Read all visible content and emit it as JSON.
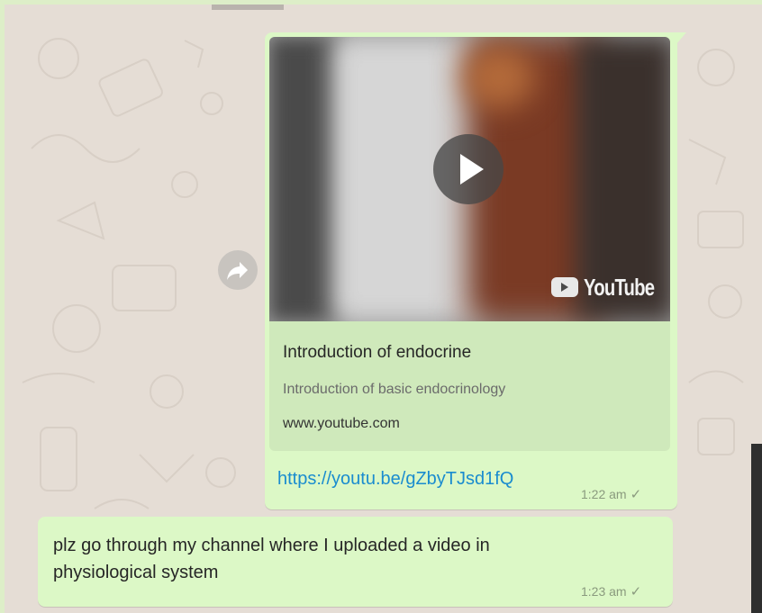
{
  "message_1": {
    "preview": {
      "title": "Introduction of endocrine",
      "description": "Introduction of basic endocrinology",
      "domain": "www.youtube.com",
      "badge": "YouTube"
    },
    "link": "https://youtu.be/gZbyTJsd1fQ",
    "time": "1:22 am",
    "status": "✓"
  },
  "message_2": {
    "text": "plz go through my channel where I uploaded a video in physiological system",
    "time": "1:23 am",
    "status": "✓"
  },
  "icons": {
    "forward": "forward-icon",
    "play": "play-icon",
    "youtube": "youtube-logo-icon",
    "tick": "single-tick-icon"
  },
  "colors": {
    "outgoing_bubble": "#dcf8c6",
    "chat_background": "#e5ddd5",
    "link": "#1a8ccf"
  }
}
